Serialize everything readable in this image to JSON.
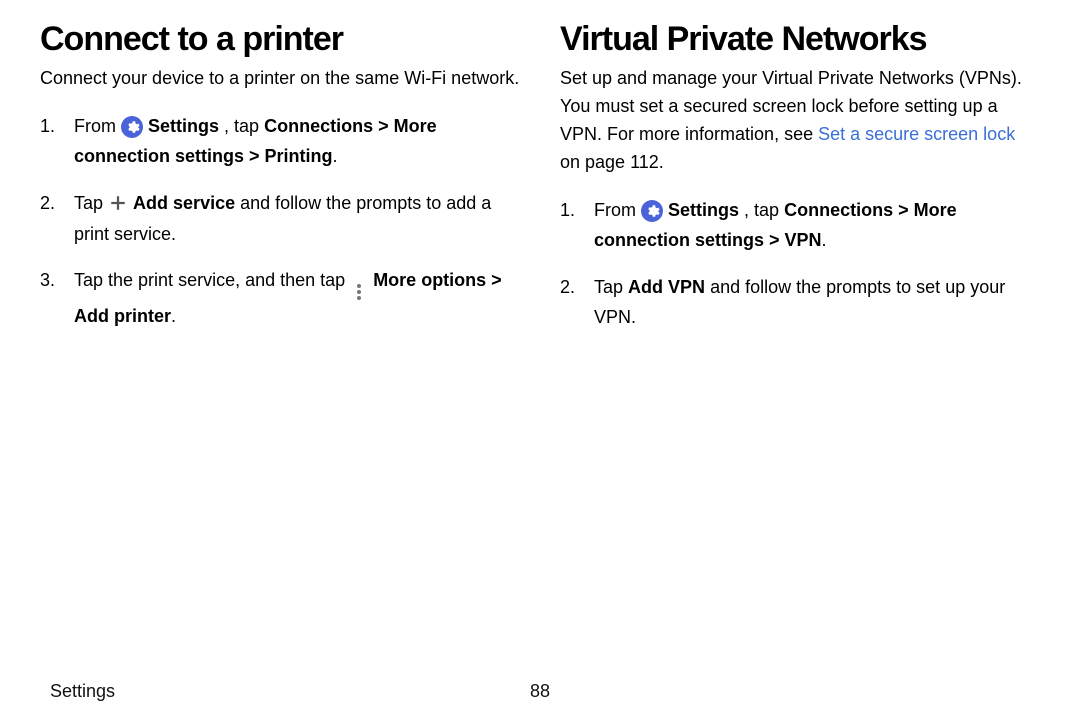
{
  "left": {
    "heading": "Connect to a printer",
    "intro": "Connect your device to a printer on the same Wi-Fi network.",
    "steps": {
      "s1": {
        "t1": "From ",
        "b1": "Settings",
        "t2": ", tap ",
        "b2": "Connections > More connection settings > Printing",
        "t3": "."
      },
      "s2": {
        "t1": "Tap ",
        "b1": "Add service",
        "t2": " and follow the prompts to add a print service."
      },
      "s3": {
        "t1": "Tap the print service, and then tap ",
        "b1": "More options > Add printer",
        "t2": "."
      }
    }
  },
  "right": {
    "heading": "Virtual Private Networks",
    "intro": {
      "t1": "Set up and manage your Virtual Private Networks (VPNs). You must set a secured screen lock before setting up a VPN. For more information, see ",
      "link": "Set a secure screen lock",
      "t2": " on page 112."
    },
    "steps": {
      "s1": {
        "t1": "From ",
        "b1": "Settings",
        "t2": ", tap ",
        "b2": "Connections > More connection settings > VPN",
        "t3": "."
      },
      "s2": {
        "t1": "Tap ",
        "b1": "Add VPN",
        "t2": " and follow the prompts to set up your VPN."
      }
    }
  },
  "footer": {
    "section": "Settings",
    "page": "88"
  }
}
